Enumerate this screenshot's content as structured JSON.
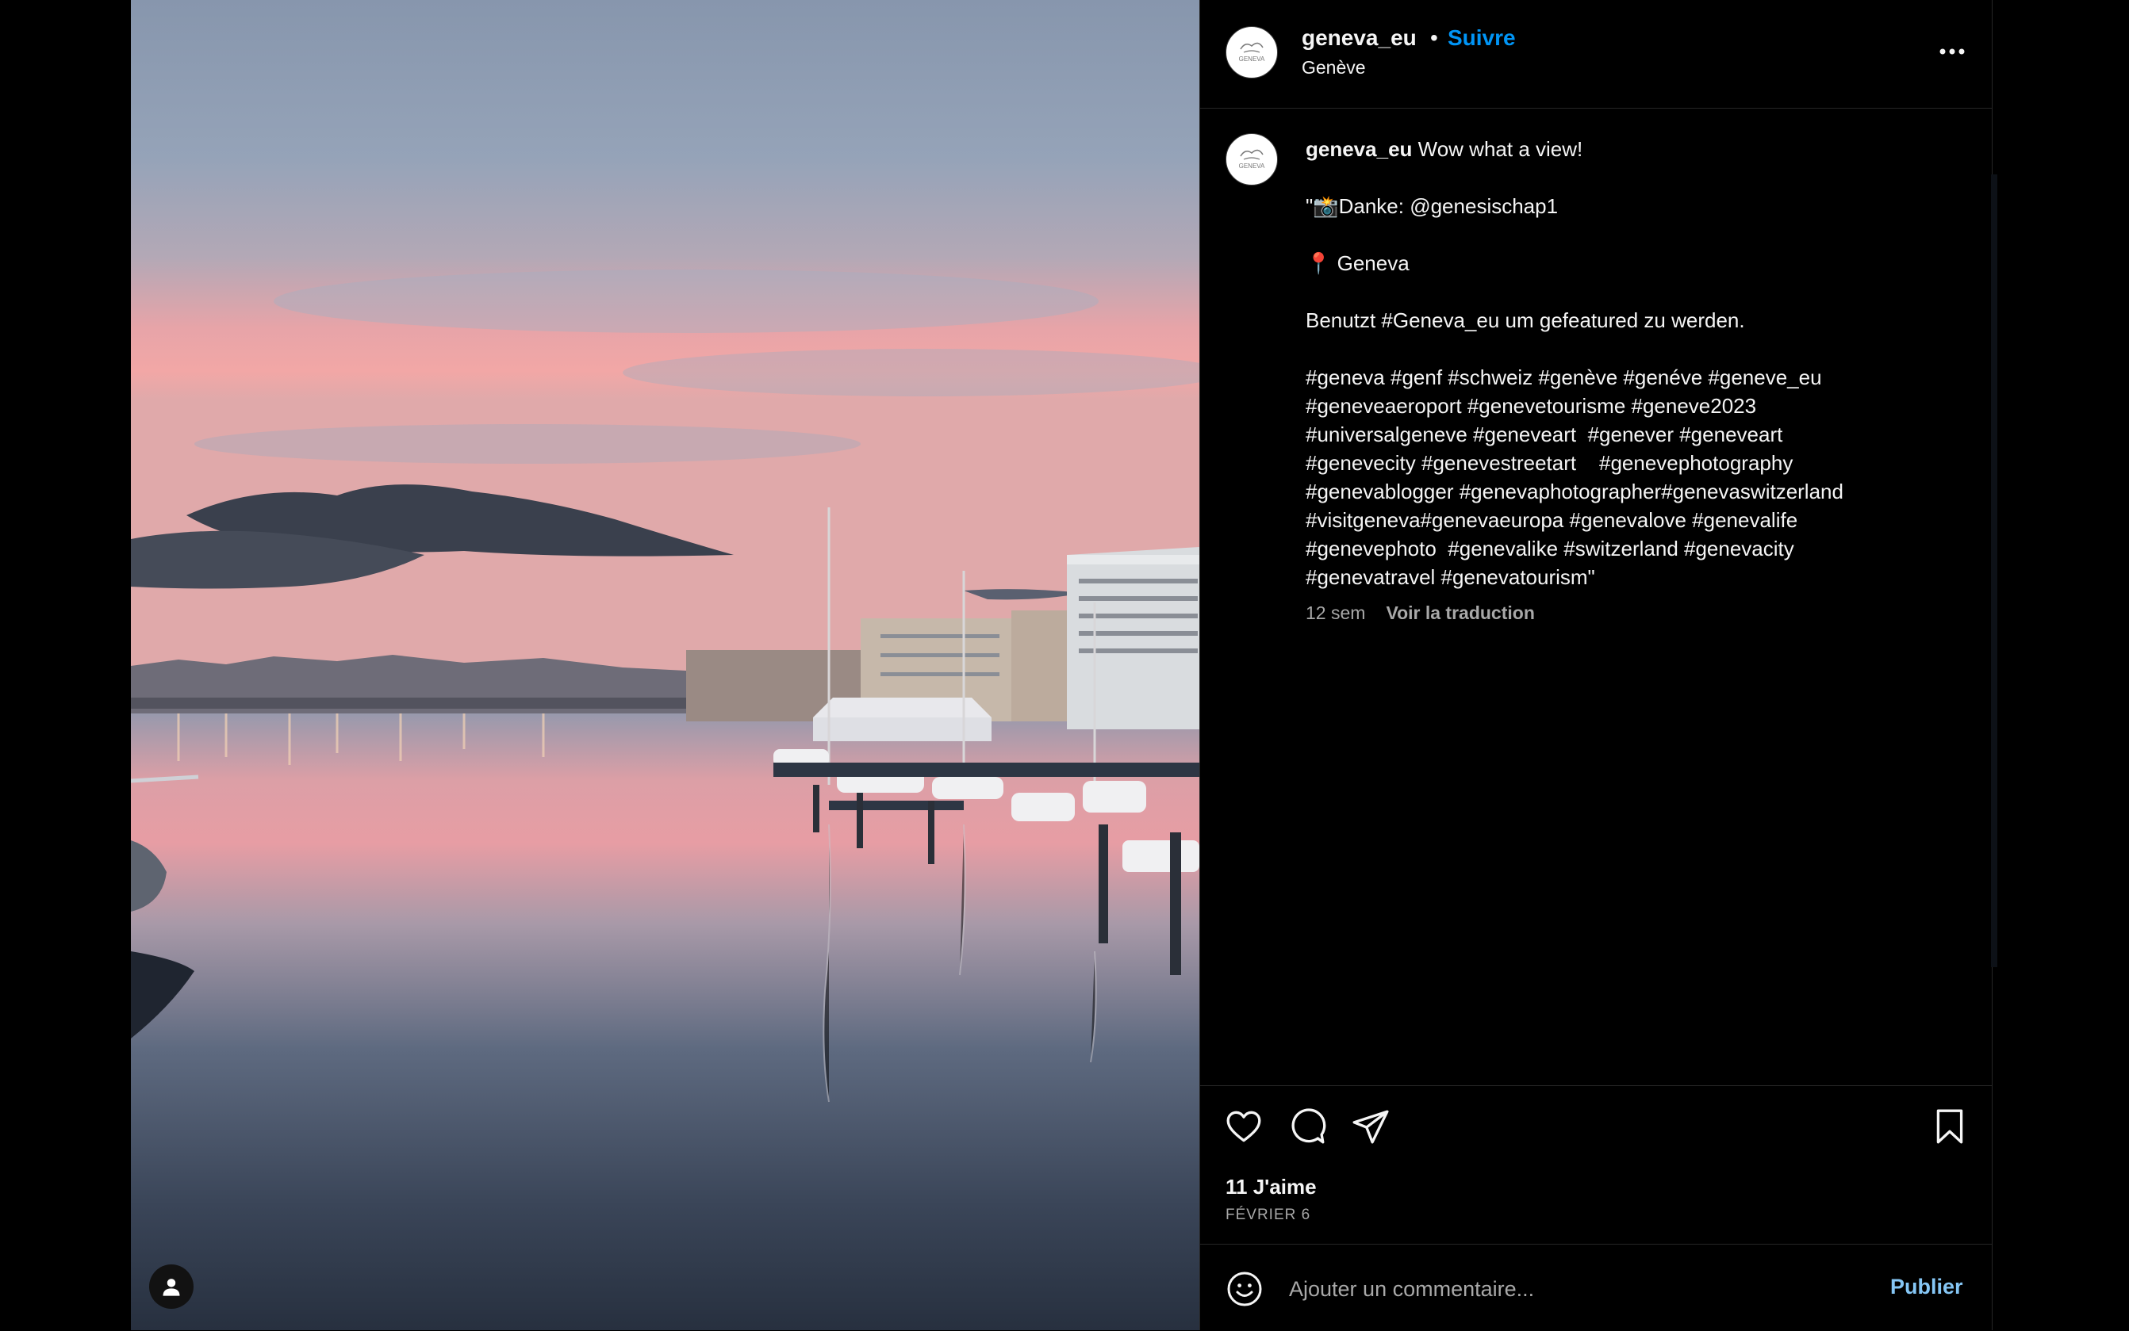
{
  "post": {
    "author": "geneva_eu",
    "avatar_text": "GENEVA",
    "follow_label": "Suivre",
    "separator": "•",
    "location": "Genève",
    "caption_first": "Wow what a view!",
    "caption_lines": [
      "\"📸Danke: @genesischap1",
      "",
      "📍 Geneva",
      "",
      "Benutzt #Geneva_eu um gefeatured zu werden.",
      "",
      "#geneva #genf #schweiz #genève #genéve #geneve_eu",
      "#geneveaeroport #genevetourisme #geneve2023",
      "#universalgeneve #geneveart  #genever #geneveart",
      "#genevecity #genevestreetart    #genevephotography",
      "#genevablogger #genevaphotographer#genevaswitzerland",
      "#visitgeneva#genevaeuropa #genevalove #genevalife",
      "#genevephoto  #genevalike #switzerland #genevacity",
      "#genevatravel #genevatourism\""
    ],
    "age": "12 sem",
    "translate_label": "Voir la traduction",
    "likes": "11 J'aime",
    "date": "FÉVRIER 6"
  },
  "comment": {
    "placeholder": "Ajouter un commentaire...",
    "publish_label": "Publier"
  },
  "icons": {
    "like": "heart-icon",
    "comment": "comment-icon",
    "share": "paper-plane-icon",
    "save": "bookmark-icon",
    "more": "more-horizontal-icon",
    "emoji": "emoji-icon",
    "user_tag": "user-icon"
  },
  "colors": {
    "accent": "#0095f6",
    "publish": "#85c6f5",
    "background": "#000000",
    "muted": "#a8a8a8"
  }
}
